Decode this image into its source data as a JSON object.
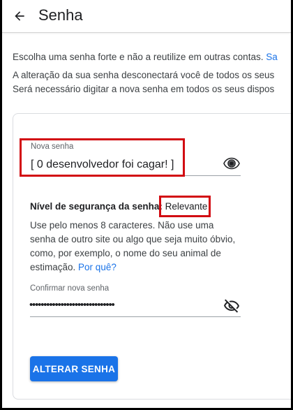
{
  "header": {
    "title": "Senha",
    "back_icon": "arrow-back-icon"
  },
  "intro": {
    "line1": "Escolha uma senha forte e não a reutilize em outras contas.",
    "line1_link": "Sa",
    "line2": "A alteração da sua senha desconectará você de todos os seus",
    "line3": "Será necessário digitar a nova senha em todos os seus dispos"
  },
  "new_password": {
    "label": "Nova senha",
    "value": "[ 0 desenvolvedor foi cagar! ]",
    "toggle_icon": "eye-icon"
  },
  "strength": {
    "label": "Nível de segurança da senha:",
    "value": "Relevante"
  },
  "hint": {
    "text": "Use pelo menos 8 caracteres. Não use uma senha de outro site ou algo que seja muito óbvio, como, por exemplo, o nome do seu animal de estimação.",
    "link": "Por quê?"
  },
  "confirm_password": {
    "label": "Confirmar nova senha",
    "value": "••••••••••••••••••••••••••••••",
    "toggle_icon": "eye-off-icon"
  },
  "submit": {
    "label": "ALTERAR SENHA"
  },
  "colors": {
    "accent": "#1a73e8",
    "highlight": "#d20a11"
  }
}
